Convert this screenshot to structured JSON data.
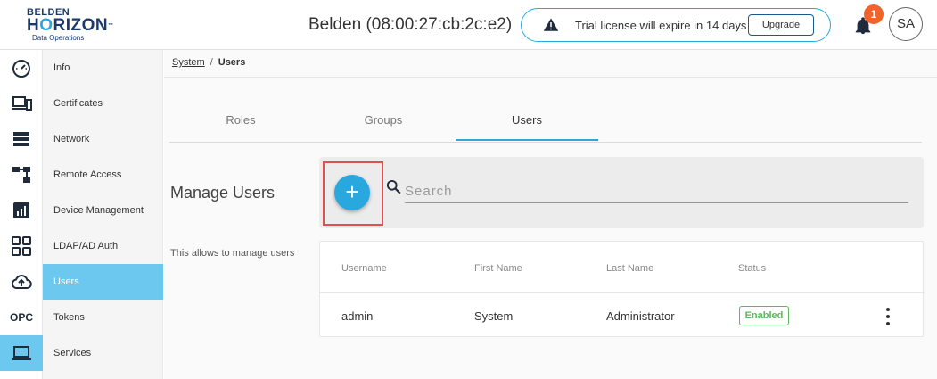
{
  "header": {
    "logo": {
      "line1": "BELDEN",
      "line2a": "H",
      "line2o": "O",
      "line2b": "RIZON",
      "tm": "™",
      "line3": "Data Operations"
    },
    "device_title": "Belden (08:00:27:cb:2c:e2)",
    "license": {
      "text": "Trial license will expire in 14 days",
      "button": "Upgrade"
    },
    "notifications_count": "1",
    "avatar_initials": "SA"
  },
  "rail": {
    "items": [
      {
        "icon": "dashboard-gauge-icon"
      },
      {
        "icon": "devices-icon"
      },
      {
        "icon": "list-icon"
      },
      {
        "icon": "topology-icon"
      },
      {
        "icon": "chart-icon"
      },
      {
        "icon": "apps-grid-icon"
      },
      {
        "icon": "cloud-upload-icon"
      },
      {
        "icon": "opc-icon",
        "label": "OPC"
      },
      {
        "icon": "laptop-icon",
        "active": true
      }
    ]
  },
  "submenu": {
    "items": [
      {
        "label": "Info"
      },
      {
        "label": "Certificates"
      },
      {
        "label": "Network"
      },
      {
        "label": "Remote Access"
      },
      {
        "label": "Device Management"
      },
      {
        "label": "LDAP/AD Auth"
      },
      {
        "label": "Users",
        "active": true
      },
      {
        "label": "Tokens"
      },
      {
        "label": "Services"
      }
    ]
  },
  "breadcrumb": {
    "parent": "System",
    "separator": "/",
    "current": "Users"
  },
  "tabs": [
    {
      "label": "Roles"
    },
    {
      "label": "Groups"
    },
    {
      "label": "Users",
      "active": true
    }
  ],
  "manage": {
    "title": "Manage Users",
    "description": "This allows to manage users"
  },
  "search": {
    "placeholder": "Search",
    "add_label": "+"
  },
  "table": {
    "columns": [
      "Username",
      "First Name",
      "Last Name",
      "Status"
    ],
    "rows": [
      {
        "username": "admin",
        "first_name": "System",
        "last_name": "Administrator",
        "status": "Enabled"
      }
    ]
  },
  "colors": {
    "accent": "#29a8e0",
    "active_nav": "#6cc8ef",
    "enabled": "#5cb85c",
    "badge": "#f0632c",
    "highlight": "#e05050"
  }
}
